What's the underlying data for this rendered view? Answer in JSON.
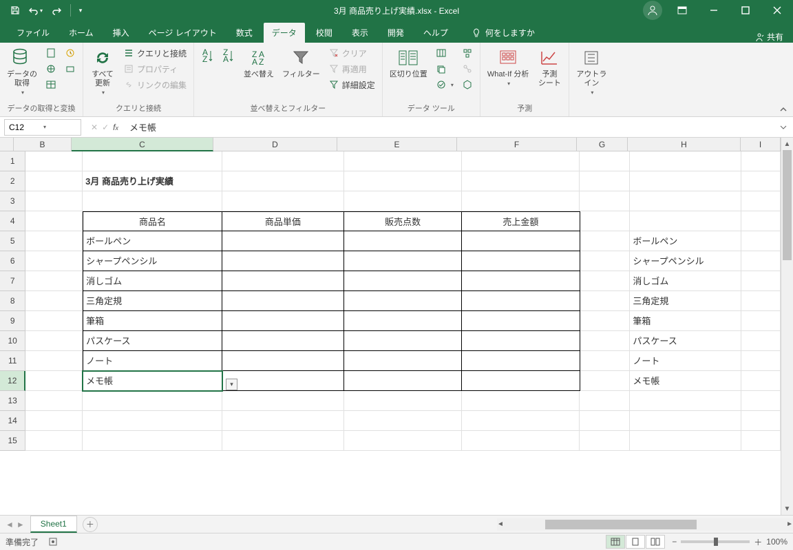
{
  "title": "3月 商品売り上げ実績.xlsx - Excel",
  "qat": {
    "save": "保存",
    "undo": "元に戻す",
    "redo": "やり直し"
  },
  "tabs": {
    "file": "ファイル",
    "home": "ホーム",
    "insert": "挿入",
    "pageLayout": "ページ レイアウト",
    "formulas": "数式",
    "data": "データ",
    "review": "校閲",
    "view": "表示",
    "developer": "開発",
    "help": "ヘルプ"
  },
  "tellMe": "何をしますか",
  "share": "共有",
  "ribbon": {
    "g1": {
      "getData": "データの\n取得",
      "label": "データの取得と変換"
    },
    "g2": {
      "refresh": "すべて\n更新",
      "query": "クエリと接続",
      "prop": "プロパティ",
      "link": "リンクの編集",
      "label": "クエリと接続"
    },
    "g3": {
      "sort": "並べ替え",
      "filter": "フィルター",
      "clear": "クリア",
      "reapply": "再適用",
      "advanced": "詳細設定",
      "label": "並べ替えとフィルター"
    },
    "g4": {
      "textCol": "区切り位置",
      "label": "データ ツール"
    },
    "g5": {
      "whatIf": "What-If 分析",
      "forecast": "予測\nシート",
      "label": "予測"
    },
    "g6": {
      "outline": "アウトラ\nイン",
      "label": ""
    }
  },
  "nameBox": "C12",
  "formulaValue": "メモ帳",
  "columns": [
    "B",
    "C",
    "D",
    "E",
    "F",
    "G",
    "H",
    "I"
  ],
  "colWidths": {
    "B": 84,
    "C": 206,
    "D": 180,
    "E": 174,
    "F": 174,
    "G": 74,
    "H": 164,
    "I": 58
  },
  "rowLabels": [
    "1",
    "2",
    "3",
    "4",
    "5",
    "6",
    "7",
    "8",
    "9",
    "10",
    "11",
    "12",
    "13",
    "14",
    "15"
  ],
  "sheetTitle": "3月 商品売り上げ実績",
  "headers": {
    "c": "商品名",
    "d": "商品単価",
    "e": "販売点数",
    "f": "売上金額"
  },
  "items": [
    "ボールペン",
    "シャープペンシル",
    "消しゴム",
    "三角定規",
    "筆箱",
    "パスケース",
    "ノート",
    "メモ帳"
  ],
  "sheetName": "Sheet1",
  "status": "準備完了",
  "zoom": "100%",
  "activeCell": {
    "row": 12,
    "col": "C"
  }
}
